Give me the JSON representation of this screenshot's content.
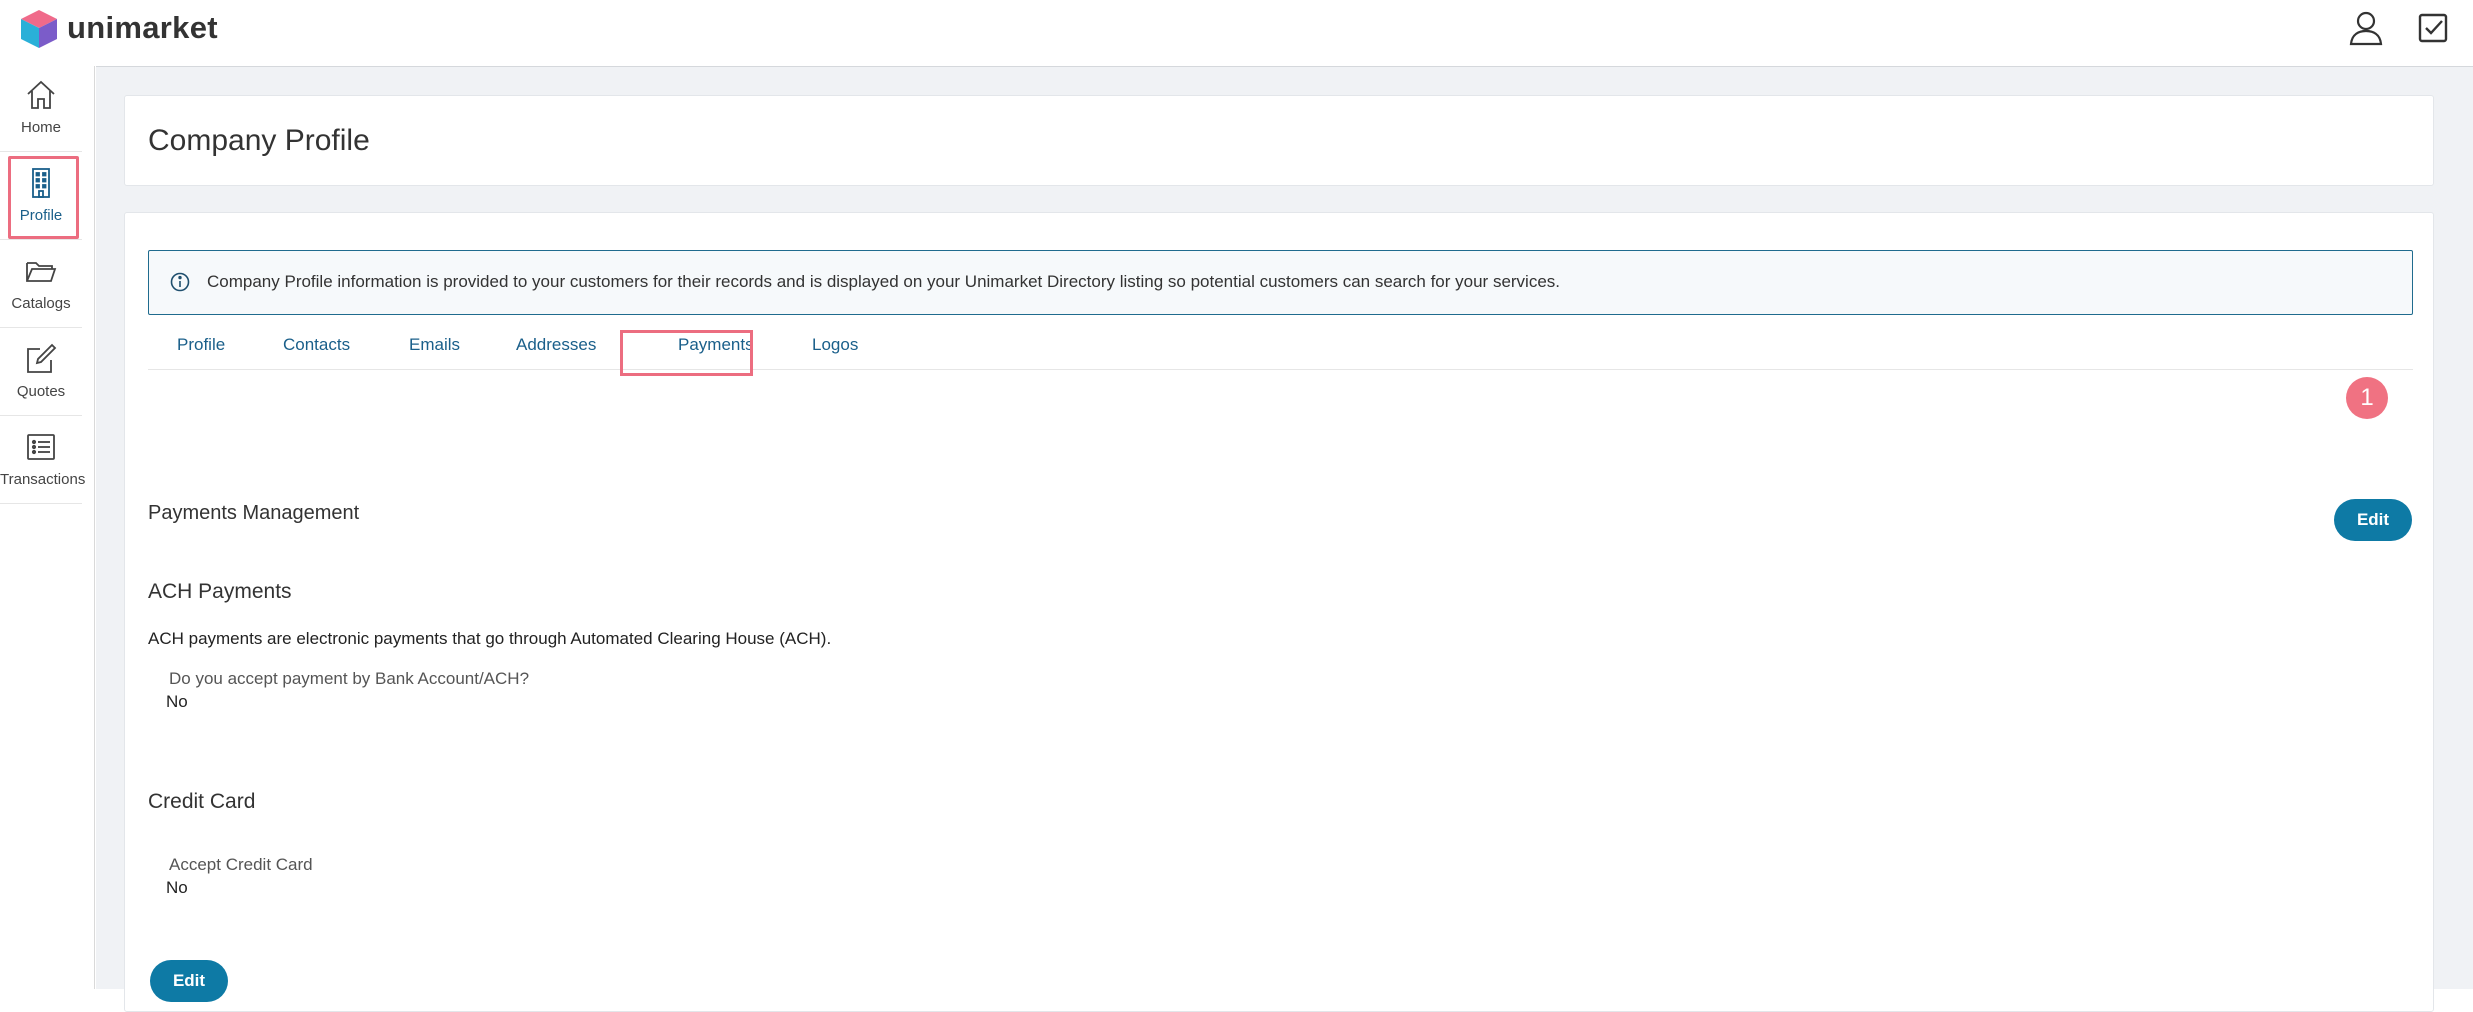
{
  "app": {
    "brand": "unimarket"
  },
  "sidebar": {
    "items": [
      {
        "label": "Home",
        "icon": "home-icon"
      },
      {
        "label": "Profile",
        "icon": "building-icon"
      },
      {
        "label": "Catalogs",
        "icon": "folder-icon"
      },
      {
        "label": "Quotes",
        "icon": "edit-icon"
      },
      {
        "label": "Transactions",
        "icon": "list-icon"
      }
    ]
  },
  "page": {
    "title": "Company Profile"
  },
  "info": {
    "text": "Company Profile information is provided to your customers for their records and is displayed on your Unimarket Directory listing so potential customers can search for your services."
  },
  "tabs": [
    {
      "label": "Profile"
    },
    {
      "label": "Contacts"
    },
    {
      "label": "Emails"
    },
    {
      "label": "Addresses"
    },
    {
      "label": "Payments"
    },
    {
      "label": "Logos"
    }
  ],
  "payments": {
    "heading": "Payments Management",
    "edit_label": "Edit",
    "ach": {
      "heading": "ACH Payments",
      "description": "ACH payments are electronic payments that go through Automated Clearing House (ACH).",
      "question": "Do you accept payment by Bank Account/ACH?",
      "value": "No"
    },
    "credit_card": {
      "heading": "Credit Card",
      "question": "Accept Credit Card",
      "value": "No"
    },
    "bottom_edit_label": "Edit"
  },
  "annotation": {
    "step": "1"
  },
  "colors": {
    "accent": "#0e7aa5",
    "highlight": "#ec6d80",
    "link": "#1a5f8a"
  }
}
